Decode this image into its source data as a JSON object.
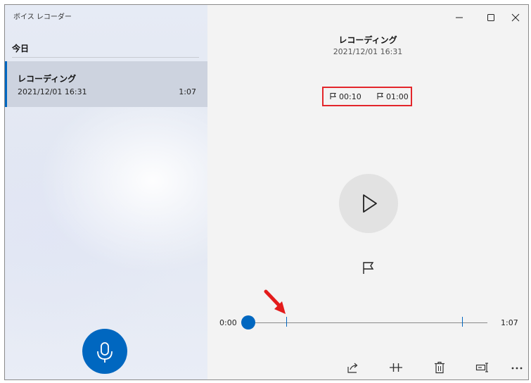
{
  "window": {
    "title": "ボイス レコーダー"
  },
  "sidebar": {
    "section_title": "今日",
    "items": [
      {
        "name": "レコーディング",
        "date": "2021/12/01 16:31",
        "duration": "1:07"
      }
    ]
  },
  "detail": {
    "title": "レコーディング",
    "date": "2021/12/01 16:31",
    "markers": [
      {
        "time": "00:10"
      },
      {
        "time": "01:00"
      }
    ]
  },
  "playback": {
    "current_time": "0:00",
    "total_time": "1:07",
    "progress": 0
  },
  "colors": {
    "accent": "#0067c0",
    "highlight_box": "#e3262b",
    "arrow": "#e31b1b"
  }
}
